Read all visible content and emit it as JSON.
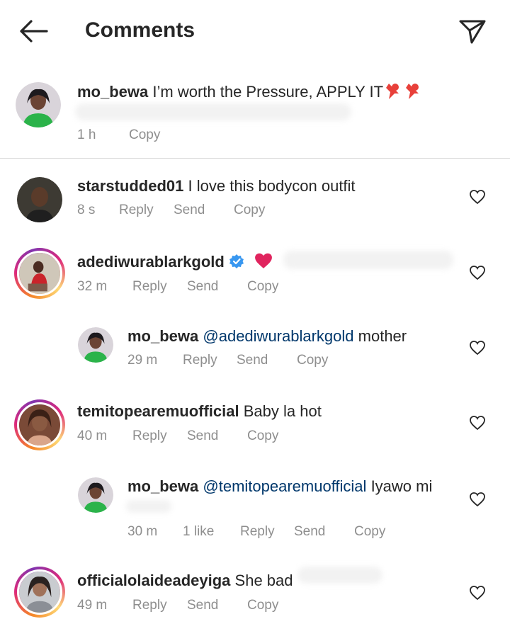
{
  "header": {
    "title": "Comments"
  },
  "caption": {
    "username": "mo_bewa",
    "text": "I’m worth the Pressure, APPLY IT",
    "time": "1 h",
    "copy_label": "Copy"
  },
  "comments": [
    {
      "username": "starstudded01",
      "text": "I love this bodycon outfit",
      "time": "8 s",
      "reply_label": "Reply",
      "send_label": "Send",
      "copy_label": "Copy"
    },
    {
      "username": "adediwurablarkgold",
      "text": "",
      "time": "32 m",
      "reply_label": "Reply",
      "send_label": "Send",
      "copy_label": "Copy"
    },
    {
      "username": "mo_bewa",
      "mention": "@adediwurablarkgold",
      "text": "mother",
      "time": "29 m",
      "reply_label": "Reply",
      "send_label": "Send",
      "copy_label": "Copy"
    },
    {
      "username": "temitopearemuofficial",
      "text": "Baby la hot",
      "time": "40 m",
      "reply_label": "Reply",
      "send_label": "Send",
      "copy_label": "Copy"
    },
    {
      "username": "mo_bewa",
      "mention": "@temitopearemuofficial",
      "text": "Iyawo mi",
      "time": "30 m",
      "likes": "1 like",
      "reply_label": "Reply",
      "send_label": "Send",
      "copy_label": "Copy"
    },
    {
      "username": "officialolaideadeyiga",
      "text": "She bad",
      "time": "49 m",
      "reply_label": "Reply",
      "send_label": "Send",
      "copy_label": "Copy"
    }
  ],
  "icons": {
    "back": "arrow-left-icon",
    "share": "paper-plane-icon",
    "like": "heart-outline-icon",
    "verified": "verified-badge-icon"
  },
  "colors": {
    "text": "#262626",
    "meta": "#8e8e8e",
    "mention": "#00376b",
    "verified": "#3897f0",
    "heart_emoji": "#e0245e"
  }
}
